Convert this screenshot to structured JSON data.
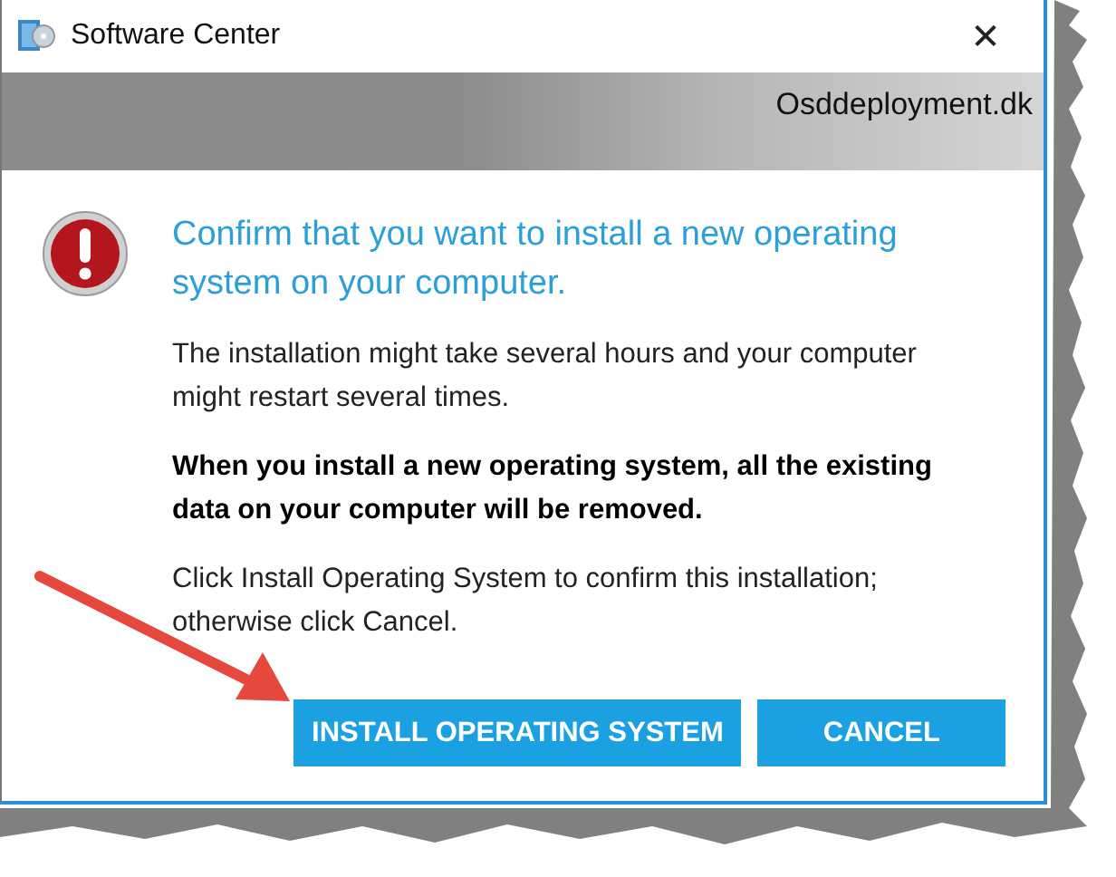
{
  "window": {
    "title": "Software Center",
    "close": "✕"
  },
  "banner": {
    "text": "Osddeployment.dk"
  },
  "message": {
    "heading": "Confirm that you want to install a new operating system on your computer.",
    "paragraphs": [
      {
        "kind": "normal",
        "text": "The installation might take several hours and your computer might restart several times."
      },
      {
        "kind": "warning",
        "text": "When you install a new operating system, all the existing data on your computer will be removed."
      },
      {
        "kind": "normal",
        "text": "Click Install Operating System to confirm this installation; otherwise click Cancel."
      }
    ]
  },
  "buttons": [
    {
      "label": "INSTALL OPERATING SYSTEM"
    },
    {
      "label": "CANCEL"
    }
  ]
}
